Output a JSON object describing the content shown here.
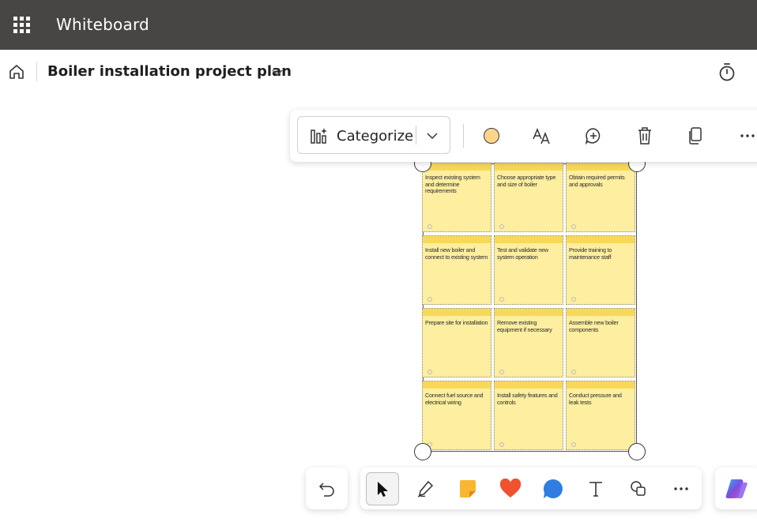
{
  "app": {
    "title": "Whiteboard"
  },
  "header": {
    "board_title": "Boiler installation project plan"
  },
  "context_toolbar": {
    "categorize_label": "Categorize",
    "selected_color": "#fbd58a",
    "buttons": [
      "color-picker",
      "text-format",
      "add-reaction",
      "delete",
      "copy",
      "more-options"
    ]
  },
  "notes": [
    {
      "text": "Inspect existing system and determine requirements"
    },
    {
      "text": "Choose appropriate type and size of boiler"
    },
    {
      "text": "Obtain required permits and approvals"
    },
    {
      "text": "Install new boiler and connect to existing system"
    },
    {
      "text": "Test and validate new system operation"
    },
    {
      "text": "Provide training to maintenance staff"
    },
    {
      "text": "Prepare site for installation"
    },
    {
      "text": "Remove existing equipment if necessary"
    },
    {
      "text": "Assemble new boiler components"
    },
    {
      "text": "Connect fuel source and electrical wiring"
    },
    {
      "text": "Install safety features and controls"
    },
    {
      "text": "Conduct pressure and leak tests"
    }
  ],
  "bottom_toolbar": {
    "tools": [
      "select",
      "pen",
      "sticky-note",
      "reactions",
      "comment",
      "text",
      "shapes",
      "more"
    ],
    "active_tool": "select"
  },
  "colors": {
    "topbar": "#484644",
    "note_fill": "#fdeea0",
    "note_band": "#f8d858"
  }
}
